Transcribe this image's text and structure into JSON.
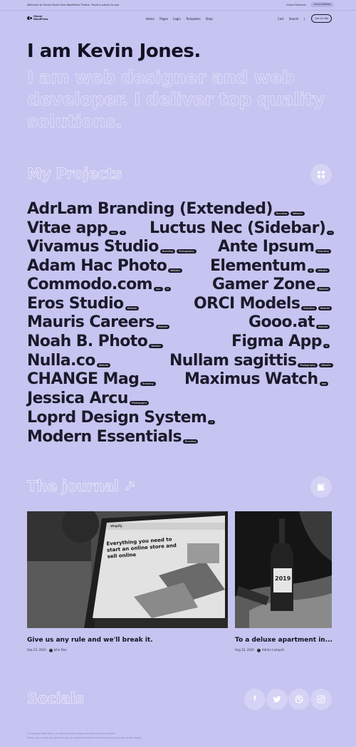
{
  "topbar": {
    "welcome": "Welcome to Ohmni Kevin Sem WordPress Theme. There is plenty to see.",
    "features": "Check Features",
    "demos": "Go to Demos"
  },
  "logo": {
    "name": "Ohmni WordPress"
  },
  "nav": {
    "items": [
      "Home",
      "Pages",
      "Login",
      "Templates",
      "Shop"
    ],
    "cart": "Cart",
    "search": "Search",
    "divider": "|",
    "cta": "Get On Me"
  },
  "hero": {
    "title": "I am Kevin Jones.",
    "subtitle": "I am web designer and web developer. I deliver top quality solutions."
  },
  "projects": {
    "heading": "My Projects",
    "items": [
      {
        "name": "AdrLam Branding (Extended)",
        "tags": [
          "Branding",
          "Website"
        ]
      },
      {
        "name": "Vitae app",
        "tags": [
          "App",
          "UI"
        ]
      },
      {
        "name": "Luctus Nec (Sidebar)",
        "tags": [
          "UI"
        ]
      },
      {
        "name": "Vivamus Studio",
        "tags": [
          "Branding",
          "Photography"
        ]
      },
      {
        "name": "Ante Ipsum",
        "tags": [
          "Branding"
        ]
      },
      {
        "name": "Adam Hac Photo",
        "tags": [
          "Website"
        ]
      },
      {
        "name": "Elementum",
        "tags": [
          "UI",
          "Website"
        ]
      },
      {
        "name": "Commodo.com",
        "tags": [
          "App",
          "UI"
        ]
      },
      {
        "name": "Gamer Zone",
        "tags": [
          "Website"
        ]
      },
      {
        "name": "Eros Studio",
        "tags": [
          "Website"
        ]
      },
      {
        "name": "ORCI Models",
        "tags": [
          "Branding",
          "Website"
        ]
      },
      {
        "name": "Mauris Careers",
        "tags": [
          "Website"
        ]
      },
      {
        "name": "Gooo.at",
        "tags": [
          "Website"
        ]
      },
      {
        "name": "Noah B. Photo",
        "tags": [
          "Website"
        ]
      },
      {
        "name": "Figma App",
        "tags": [
          "UI"
        ]
      },
      {
        "name": "Nulla.co",
        "tags": [
          "Website"
        ]
      },
      {
        "name": "Nullam sagittis",
        "tags": [
          "Photography",
          "Website"
        ]
      },
      {
        "name": "CHANGE Mag",
        "tags": [
          "Branding"
        ]
      },
      {
        "name": "Maximus Watch",
        "tags": [
          "App"
        ]
      },
      {
        "name": "Jessica Arcu",
        "tags": [
          "Photography"
        ]
      },
      {
        "name": "Loprd Design System",
        "tags": [
          "UI"
        ]
      },
      {
        "name": "Modern Essentials",
        "tags": [
          "Branding"
        ]
      }
    ]
  },
  "journal": {
    "heading": "The journal ↗",
    "posts": [
      {
        "title": "Give us any rule and we'll break it.",
        "date": "Sep 23, 2020",
        "author": "John Doe",
        "image_headline": "Everything you need to start an online store and sell online",
        "image_brand": "shopify"
      },
      {
        "title": "To a deluxe apartment in...",
        "date": "Aug 16, 2020",
        "author": "Adrian Lampart",
        "image_label": "2019"
      }
    ]
  },
  "socials": {
    "heading": "Socials",
    "icons": [
      "f",
      "t",
      "d",
      "ig"
    ]
  },
  "footer": {
    "line1": "© Copyright 2020 Ohmni. All rights reserved. Images are used for demo purposes.",
    "line2": "Ohmni uses cookies. By using this site, you agree to the terms of service and privacy policy of this website."
  },
  "colors": {
    "background": "#c6c4f0",
    "text": "#1a1a2a",
    "outline": "#eeedfc",
    "button_bg": "#d4d2f5"
  }
}
